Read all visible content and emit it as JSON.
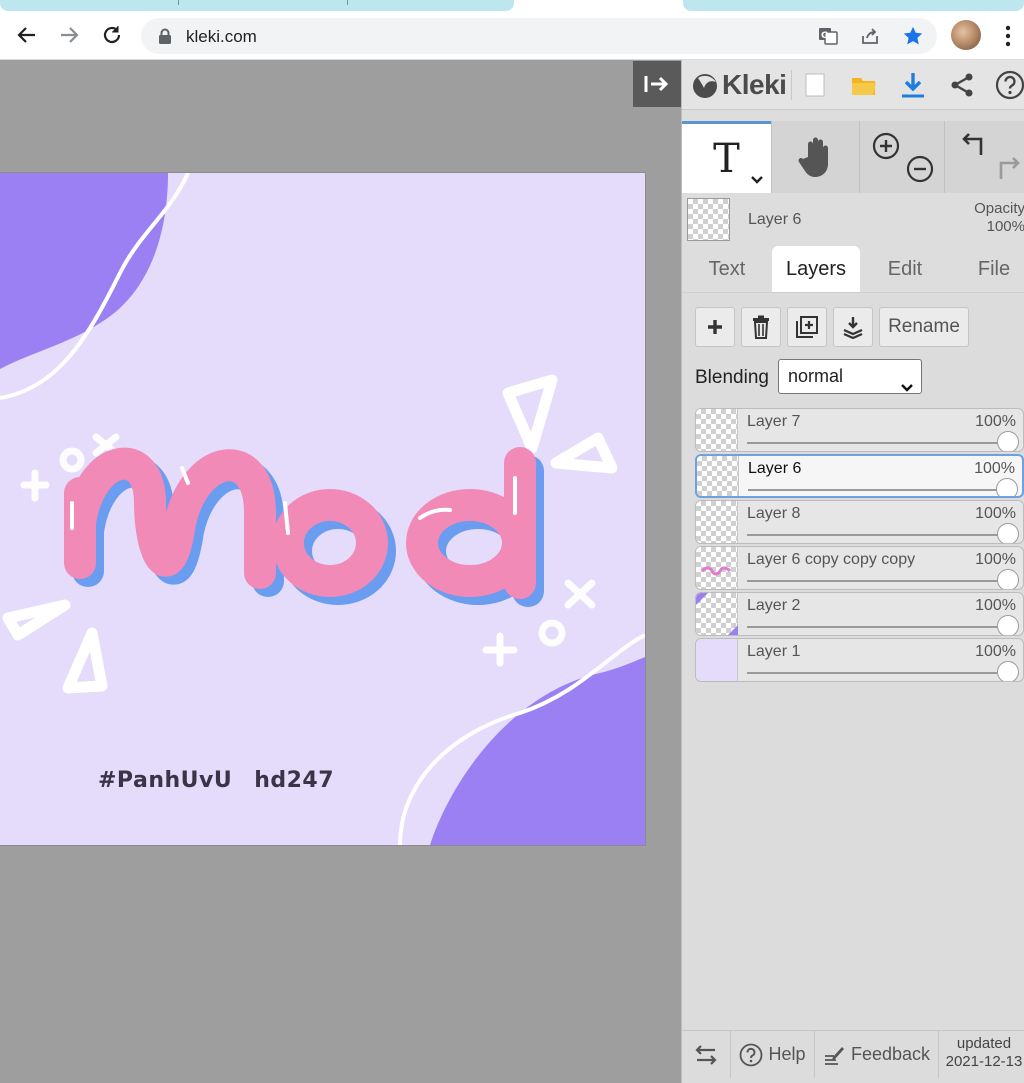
{
  "browser": {
    "url": "kleki.com",
    "icons": [
      "back-arrow-icon",
      "forward-arrow-icon",
      "reload-icon",
      "lock-icon",
      "translate-icon",
      "share-icon",
      "bookmark-star-icon",
      "kebab-menu-icon"
    ],
    "accent": "#1a73e8"
  },
  "app": {
    "name": "Kleki",
    "panel_icons": [
      "new-image-icon",
      "open-folder-icon",
      "download-icon",
      "share-icon",
      "help-icon"
    ]
  },
  "toolbar": {
    "active_tool": "T",
    "tools": [
      "text-tool",
      "hand-tool",
      "zoom-in-icon",
      "zoom-out-icon",
      "undo-icon",
      "redo-icon"
    ]
  },
  "current_layer": {
    "name": "Layer 6",
    "opacity_label": "Opacity",
    "opacity_value": "100%"
  },
  "tabs": [
    "Text",
    "Layers",
    "Edit",
    "File"
  ],
  "active_tab": "Layers",
  "layer_actions": {
    "rename": "Rename",
    "icons": [
      "add-layer-icon",
      "delete-layer-icon",
      "duplicate-layer-icon",
      "merge-down-icon"
    ]
  },
  "blending": {
    "label": "Blending",
    "value": "normal"
  },
  "layers": [
    {
      "name": "Layer 7",
      "opacity": "100%",
      "selected": false
    },
    {
      "name": "Layer 6",
      "opacity": "100%",
      "selected": true
    },
    {
      "name": "Layer 8",
      "opacity": "100%",
      "selected": false
    },
    {
      "name": "Layer 6 copy copy copy",
      "opacity": "100%",
      "selected": false
    },
    {
      "name": "Layer 2",
      "opacity": "100%",
      "selected": false
    },
    {
      "name": "Layer 1",
      "opacity": "100%",
      "selected": false
    }
  ],
  "canvas": {
    "headline": "mod",
    "caption_left": "#PanhUvU",
    "caption_right": "hd247",
    "colors": {
      "bg": "#e4dcfa",
      "blob": "#9a80f2",
      "text_pink": "#f28ab8",
      "shadow_blue": "#6a9cf0"
    }
  },
  "footer": {
    "help": "Help",
    "feedback": "Feedback",
    "updated_label": "updated",
    "updated_date": "2021-12-13"
  }
}
